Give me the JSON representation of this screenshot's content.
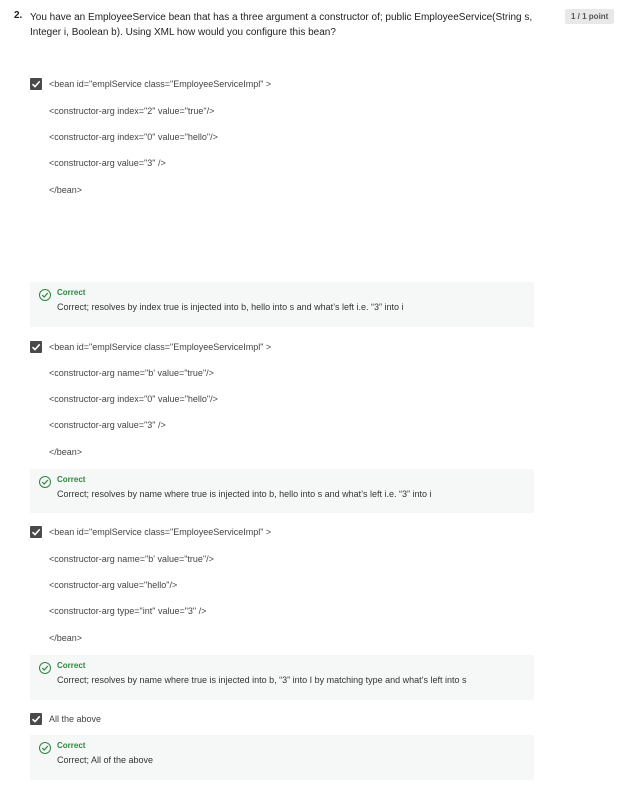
{
  "question": {
    "number": "2.",
    "text": "You have an EmployeeService bean that has a three argument a constructor of; public EmployeeService(String s, Integer i, Boolean b). Using XML how would you configure this bean?",
    "points": "1 / 1 point"
  },
  "options": [
    {
      "checked": true,
      "lines": [
        "<bean id=\"emplService class=\"EmployeeServiceImpl\" >",
        "<constructor-arg index=\"2\" value=\"true\"/>",
        "<constructor-arg index=\"0\" value=\"hello\"/>",
        "<constructor-arg value=\"3\" />",
        "</bean>"
      ],
      "feedback": {
        "title": "Correct",
        "text": "Correct; resolves by index true is injected into b, hello into s and what’s left i.e. “3” into i"
      }
    },
    {
      "checked": true,
      "lines": [
        "<bean id=\"emplService class=\"EmployeeServiceImpl\" >",
        "<constructor-arg name=\"b' value=\"true\"/>",
        "<constructor-arg index=\"0\" value=\"hello\"/>",
        "<constructor-arg value=\"3\" />",
        "</bean>"
      ],
      "feedback": {
        "title": "Correct",
        "text": "Correct; resolves by name where true is injected into b, hello into s and what’s left i.e. “3” into i"
      }
    },
    {
      "checked": true,
      "lines": [
        "<bean id=\"emplService class=\"EmployeeServiceImpl\" >",
        "<constructor-arg name=\"b' value=\"true\"/>",
        "<constructor-arg value=\"hello\"/>",
        "<constructor-arg type=\"int\" value=\"3\" />",
        "</bean>"
      ],
      "feedback": {
        "title": "Correct",
        "text": "Correct; resolves by name where true is injected into b, “3” into I by matching type and what’s left into s"
      }
    },
    {
      "checked": true,
      "lines": [
        "All the above"
      ],
      "feedback": {
        "title": "Correct",
        "text": "Correct; All of the above"
      }
    }
  ],
  "colors": {
    "correct": "#2e8540",
    "checkbox": "#4a4a4a",
    "feedback_bg": "#f6f8f7"
  },
  "icons": {
    "checkbox": "checkbox-checked-icon",
    "feedback": "check-circle-icon"
  }
}
